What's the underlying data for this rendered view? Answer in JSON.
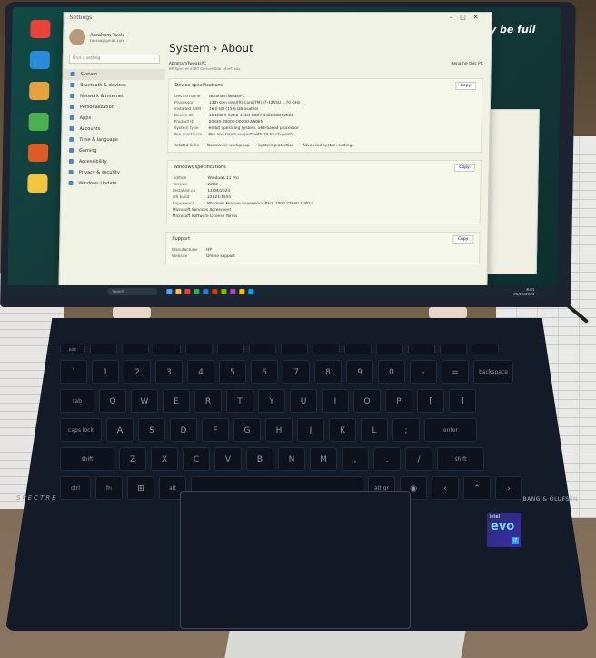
{
  "settings_window": {
    "breadcrumb": "System",
    "separator": "›",
    "page": "About",
    "app_name": "Settings",
    "user_name": "Abraham Tweki",
    "user_email": "tabraa@gmail.com",
    "search_placeholder": "Find a setting",
    "nav": [
      {
        "label": "System"
      },
      {
        "label": "Bluetooth & devices"
      },
      {
        "label": "Network & internet"
      },
      {
        "label": "Personalization"
      },
      {
        "label": "Apps"
      },
      {
        "label": "Accounts"
      },
      {
        "label": "Time & language"
      },
      {
        "label": "Gaming"
      },
      {
        "label": "Accessibility"
      },
      {
        "label": "Privacy & security"
      },
      {
        "label": "Windows Update"
      }
    ],
    "device_name": "AbrahamTweakiPC",
    "device_model": "HP Spectre x360 Convertible 14-ef1xxx",
    "rename_label": "Rename this PC",
    "device_spec_title": "Device specifications",
    "copy_label": "Copy",
    "device_specs": [
      {
        "k": "Device name",
        "v": "AbrahamTweakiPC"
      },
      {
        "k": "Processor",
        "v": "12th Gen Intel(R) Core(TM) i7-1255U   1.70 GHz"
      },
      {
        "k": "Installed RAM",
        "v": "16.0 GB (15.6 GB usable)"
      },
      {
        "k": "Device ID",
        "v": "3D4EBF9-5AC0-4C18-8BB7-432C48D5286B"
      },
      {
        "k": "Product ID",
        "v": "00330-80000-00000-AA0EM"
      },
      {
        "k": "System type",
        "v": "64-bit operating system, x64-based processor"
      },
      {
        "k": "Pen and touch",
        "v": "Pen and touch support with 10 touch points"
      }
    ],
    "related_links_label": "Related links",
    "related_links": [
      "Domain or workgroup",
      "System protection",
      "Advanced system settings"
    ],
    "windows_spec_title": "Windows specifications",
    "windows_specs": [
      {
        "k": "Edition",
        "v": "Windows 11 Pro"
      },
      {
        "k": "Version",
        "v": "22H2"
      },
      {
        "k": "Installed on",
        "v": "12/04/2023"
      },
      {
        "k": "OS build",
        "v": "22621.1555"
      },
      {
        "k": "Experience",
        "v": "Windows Feature Experience Pack 1000.22640.1000.0"
      }
    ],
    "ms_service": "Microsoft Services Agreement",
    "ms_license": "Microsoft Software License Terms",
    "support_title": "Support",
    "support_specs": [
      {
        "k": "Manufacturer",
        "v": "HP"
      },
      {
        "k": "Website",
        "v": "Online support"
      }
    ]
  },
  "desktop": {
    "watermark_text": "ay be full",
    "taskbar_search": "Search",
    "clock_time": "8:01",
    "clock_date": "05/05/2023"
  },
  "laptop": {
    "brand": "SPECTRE",
    "audio_brand": "BANG & OLUFSEN",
    "sticker_intel": "intel",
    "sticker_evo": "evo",
    "sticker_badge": "i7"
  },
  "keyboard": {
    "row1": [
      "Q",
      "W",
      "E",
      "R",
      "T",
      "Y",
      "U",
      "I",
      "O",
      "P"
    ],
    "row2": [
      "A",
      "S",
      "D",
      "F",
      "G",
      "H",
      "J",
      "K",
      "L"
    ],
    "row3": [
      "Z",
      "X",
      "C",
      "V",
      "B",
      "N",
      "M"
    ]
  }
}
